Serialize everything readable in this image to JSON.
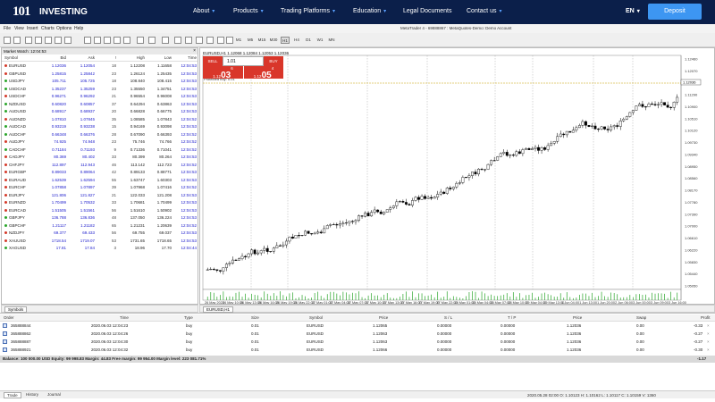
{
  "nav": {
    "logo_num": "101",
    "logo_text": "INVESTING",
    "items": [
      {
        "label": "About",
        "caret": "▾"
      },
      {
        "label": "Products",
        "caret": "▾"
      },
      {
        "label": "Trading Platforms",
        "caret": "▾"
      },
      {
        "label": "Education",
        "caret": "▾"
      },
      {
        "label": "Legal Documents",
        "caret": ""
      },
      {
        "label": "Contact us",
        "caret": "▾"
      }
    ],
    "lang": "EN",
    "lang_caret": "▾",
    "deposit": "Deposit"
  },
  "menu": [
    "File",
    "View",
    "Insert",
    "Charts",
    "Options",
    "Help"
  ],
  "title_bar": "MetaTrader 4 - 69888867 : MetaQuotes-Demo: Demo Account",
  "timeframes": [
    "M1",
    "M5",
    "M15",
    "M30",
    "H1",
    "H4",
    "D1",
    "W1",
    "MN"
  ],
  "active_timeframe": "H1",
  "mql": "MQL5 community",
  "market_watch": {
    "title": "Market Watch: 12:04:53",
    "close": "×",
    "headers": [
      "Symbol",
      "Bid",
      "Ask",
      "!",
      "High",
      "Low",
      "Time"
    ],
    "rows": [
      {
        "sym": "EURUSD",
        "bid": "1.12036",
        "ask": "1.12054",
        "spr": "18",
        "high": "1.12208",
        "low": "1.11658",
        "time": "12:04:53",
        "dir": "down"
      },
      {
        "sym": "GBPUSD",
        "bid": "1.25815",
        "ask": "1.25842",
        "spr": "23",
        "high": "1.26124",
        "low": "1.25435",
        "time": "12:04:53",
        "dir": "down"
      },
      {
        "sym": "USDJPY",
        "bid": "105.711",
        "ask": "105.725",
        "spr": "18",
        "high": "108.840",
        "low": "108.415",
        "time": "12:04:53",
        "dir": "up"
      },
      {
        "sym": "USDCAD",
        "bid": "1.35237",
        "ask": "1.35259",
        "spr": "23",
        "high": "1.35550",
        "low": "1.34751",
        "time": "12:04:53",
        "dir": "up"
      },
      {
        "sym": "USDCHF",
        "bid": "0.96271",
        "ask": "0.96292",
        "spr": "21",
        "high": "0.96554",
        "low": "0.96008",
        "time": "12:04:53",
        "dir": "down"
      },
      {
        "sym": "NZDUSD",
        "bid": "0.60820",
        "ask": "0.60857",
        "spr": "37",
        "high": "0.64294",
        "low": "0.63863",
        "time": "12:04:53",
        "dir": "up"
      },
      {
        "sym": "AUDUSD",
        "bid": "0.68917",
        "ask": "0.68937",
        "spr": "20",
        "high": "0.66828",
        "low": "0.66775",
        "time": "12:04:53",
        "dir": "up"
      },
      {
        "sym": "AUDNZD",
        "bid": "1.07810",
        "ask": "1.07845",
        "spr": "35",
        "high": "1.08585",
        "low": "1.07843",
        "time": "12:04:52",
        "dir": "down"
      },
      {
        "sym": "AUDCAD",
        "bid": "0.93219",
        "ask": "0.93238",
        "spr": "15",
        "high": "0.94169",
        "low": "0.93098",
        "time": "12:04:53",
        "dir": "up"
      },
      {
        "sym": "AUDCHF",
        "bid": "0.66348",
        "ask": "0.66376",
        "spr": "28",
        "high": "0.67090",
        "low": "0.66393",
        "time": "12:04:52",
        "dir": "up"
      },
      {
        "sym": "AUDJPY",
        "bid": "74.925",
        "ask": "74.948",
        "spr": "23",
        "high": "75.746",
        "low": "74.766",
        "time": "12:04:52",
        "dir": "down"
      },
      {
        "sym": "CADCHF",
        "bid": "0.71184",
        "ask": "0.71193",
        "spr": "9",
        "high": "0.71336",
        "low": "0.71041",
        "time": "12:04:52",
        "dir": "up"
      },
      {
        "sym": "CADJPY",
        "bid": "80.369",
        "ask": "80.402",
        "spr": "33",
        "high": "80.399",
        "low": "80.264",
        "time": "12:04:53",
        "dir": "down"
      },
      {
        "sym": "CHFJPY",
        "bid": "112.897",
        "ask": "112.943",
        "spr": "46",
        "high": "113.142",
        "low": "112.723",
        "time": "12:04:52",
        "dir": "down"
      },
      {
        "sym": "EURGBP",
        "bid": "0.89033",
        "ask": "0.89064",
        "spr": "42",
        "high": "0.89133",
        "low": "0.88771",
        "time": "12:04:53",
        "dir": "down"
      },
      {
        "sym": "EURAUD",
        "bid": "1.62539",
        "ask": "1.62594",
        "spr": "55",
        "high": "1.63747",
        "low": "1.60303",
        "time": "12:04:53",
        "dir": "down"
      },
      {
        "sym": "EURCHF",
        "bid": "1.07858",
        "ask": "1.07897",
        "spr": "39",
        "high": "1.07968",
        "low": "1.07416",
        "time": "12:04:52",
        "dir": "down"
      },
      {
        "sym": "EURJPY",
        "bid": "121.806",
        "ask": "121.827",
        "spr": "21",
        "high": "122.033",
        "low": "121.208",
        "time": "12:04:53",
        "dir": "down"
      },
      {
        "sym": "EURNZD",
        "bid": "1.70499",
        "ask": "1.70532",
        "spr": "33",
        "high": "1.70681",
        "low": "1.70499",
        "time": "12:04:53",
        "dir": "down"
      },
      {
        "sym": "EURCAD",
        "bid": "1.51505",
        "ask": "1.51561",
        "spr": "56",
        "high": "1.51610",
        "low": "1.50902",
        "time": "12:04:53",
        "dir": "down"
      },
      {
        "sym": "GBPJPY",
        "bid": "136.788",
        "ask": "136.836",
        "spr": "48",
        "high": "137.050",
        "low": "136.224",
        "time": "12:04:53",
        "dir": "up"
      },
      {
        "sym": "GBPCHF",
        "bid": "1.21117",
        "ask": "1.21182",
        "spr": "65",
        "high": "1.21231",
        "low": "1.20639",
        "time": "12:04:52",
        "dir": "up"
      },
      {
        "sym": "NZDJPY",
        "bid": "69.377",
        "ask": "69.433",
        "spr": "56",
        "high": "69.755",
        "low": "69.037",
        "time": "12:04:53",
        "dir": "down"
      },
      {
        "sym": "XAUUSD",
        "bid": "1718.54",
        "ask": "1719.07",
        "spr": "53",
        "high": "1731.65",
        "low": "1718.65",
        "time": "12:04:53",
        "dir": "down"
      },
      {
        "sym": "XAGUSD",
        "bid": "17.81",
        "ask": "17.84",
        "spr": "3",
        "high": "18.96",
        "low": "17.70",
        "time": "12:04:44",
        "dir": "up"
      }
    ],
    "tab": "Symbols"
  },
  "chart": {
    "info": "EURUSD,H1  1.12068 1.12084 1.12053 1.12036",
    "sell_label": "SELL",
    "buy_label": "BUY",
    "lot": "1.01",
    "sell_price_a": "1.12",
    "sell_price_b": "03",
    "sell_price_c": "6",
    "buy_price_a": "1.12",
    "buy_price_b": "05",
    "buy_price_c": "4",
    "level_label": "Protected buy: 0.01",
    "price_tag": "1.12036",
    "tab": "EURUSD,H1",
    "price_labels": [
      "1.12460",
      "1.12070",
      "1.11680",
      "1.11290",
      "1.10900",
      "1.10510",
      "1.10120",
      "1.09730",
      "1.09340",
      "1.08950",
      "1.08560",
      "1.08170",
      "1.07780",
      "1.07390",
      "1.07000",
      "1.06610",
      "1.06220",
      "1.05830",
      "1.05440",
      "1.05050"
    ],
    "time_labels": [
      "26 May 2020",
      "26 May 10:00",
      "26 May 13:00",
      "26 May 16:00",
      "26 May 19:00",
      "26 May 22:00",
      "27 May 01:00",
      "27 May 04:00",
      "27 May 07:00",
      "27 May 10:00",
      "27 May 13:00",
      "27 May 16:00",
      "27 May 19:00",
      "27 May 22:00",
      "28 May 01:00",
      "28 May 04:00",
      "28 May 07:00",
      "28 May 10:00",
      "29 May 04:00",
      "29 May 13:00",
      "1 Jun 04:00",
      "1 Jun 13:00",
      "1 Jun 20:00",
      "2 Jun 06:00",
      "3 Jun 00:00",
      "3 Jun 09:00",
      "3 Jun 16:00"
    ]
  },
  "trade": {
    "headers": {
      "order": "Order",
      "time": "Time",
      "type": "Type",
      "size": "Size",
      "symbol": "Symbol",
      "price": "Price",
      "sl": "S / L",
      "tp": "T / P",
      "price2": "Price",
      "swap": "Swap",
      "profit": "Profit"
    },
    "rows": [
      {
        "order": "365888844",
        "time": "2020.06.03 12:04:23",
        "type": "buy",
        "size": "0.01",
        "symbol": "EURUSD",
        "price": "1.12065",
        "sl": "0.00000",
        "tp": "0.00000",
        "price2": "1.12036",
        "swap": "0.00",
        "profit": "-0.33"
      },
      {
        "order": "365888862",
        "time": "2020.06.03 12:04:26",
        "type": "buy",
        "size": "0.01",
        "symbol": "EURUSD",
        "price": "1.12063",
        "sl": "0.00000",
        "tp": "0.00000",
        "price2": "1.12036",
        "swap": "0.00",
        "profit": "-0.27"
      },
      {
        "order": "365888887",
        "time": "2020.06.03 12:04:30",
        "type": "buy",
        "size": "0.01",
        "symbol": "EURUSD",
        "price": "1.12063",
        "sl": "0.00000",
        "tp": "0.00000",
        "price2": "1.12036",
        "swap": "0.00",
        "profit": "-0.27"
      },
      {
        "order": "365888921",
        "time": "2020.06.03 12:04:32",
        "type": "buy",
        "size": "0.01",
        "symbol": "EURUSD",
        "price": "1.12066",
        "sl": "0.00000",
        "tp": "0.00000",
        "price2": "1.12036",
        "swap": "0.00",
        "profit": "-0.30"
      }
    ],
    "close_glyph": "×",
    "balance": "Balance: 100 000.00 USD  Equity: 99 998.83  Margin: 44.83  Free margin: 99 954.00  Margin level: 223 081.71%",
    "total": "-1.17"
  },
  "bottom_tabs": [
    {
      "label": "Trade",
      "active": true
    },
    {
      "label": "History",
      "active": false
    },
    {
      "label": "Journal",
      "active": false
    }
  ],
  "status": "2020.05.28 02:00    O: 1.10123    H: 1.10162    L: 1.10117    C: 1.10159    V: 1360"
}
